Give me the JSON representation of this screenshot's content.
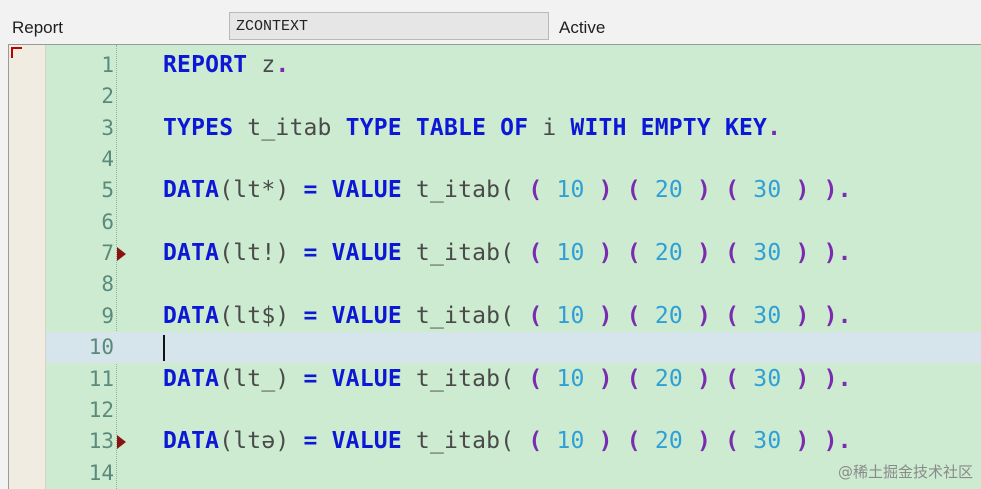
{
  "header": {
    "type_label": "Report",
    "program_name": "ZCONTEXT",
    "status": "Active"
  },
  "editor": {
    "lines": [
      {
        "num": "1",
        "breakpoint": false,
        "current": false,
        "tokens": [
          [
            "kw",
            "REPORT"
          ],
          [
            "id",
            " z"
          ],
          [
            "pn",
            "."
          ]
        ]
      },
      {
        "num": "2",
        "breakpoint": false,
        "current": false,
        "tokens": []
      },
      {
        "num": "3",
        "breakpoint": false,
        "current": false,
        "tokens": [
          [
            "kw",
            "TYPES"
          ],
          [
            "id",
            " t_itab "
          ],
          [
            "kw",
            "TYPE TABLE OF"
          ],
          [
            "id",
            " i "
          ],
          [
            "kw",
            "WITH EMPTY KEY"
          ],
          [
            "pn",
            "."
          ]
        ]
      },
      {
        "num": "4",
        "breakpoint": false,
        "current": false,
        "tokens": []
      },
      {
        "num": "5",
        "breakpoint": false,
        "current": false,
        "tokens": [
          [
            "kw",
            "DATA"
          ],
          [
            "id",
            "(lt*) "
          ],
          [
            "kw",
            "="
          ],
          [
            "id",
            " "
          ],
          [
            "kw",
            "VALUE"
          ],
          [
            "id",
            " t_itab( "
          ],
          [
            "pn",
            "("
          ],
          [
            "id",
            " "
          ],
          [
            "num",
            "10"
          ],
          [
            "id",
            " "
          ],
          [
            "pn",
            ")"
          ],
          [
            "id",
            " "
          ],
          [
            "pn",
            "("
          ],
          [
            "id",
            " "
          ],
          [
            "num",
            "20"
          ],
          [
            "id",
            " "
          ],
          [
            "pn",
            ")"
          ],
          [
            "id",
            " "
          ],
          [
            "pn",
            "("
          ],
          [
            "id",
            " "
          ],
          [
            "num",
            "30"
          ],
          [
            "id",
            " "
          ],
          [
            "pn",
            ")"
          ],
          [
            "id",
            " "
          ],
          [
            "pn",
            ")."
          ]
        ]
      },
      {
        "num": "6",
        "breakpoint": false,
        "current": false,
        "tokens": []
      },
      {
        "num": "7",
        "breakpoint": true,
        "current": false,
        "tokens": [
          [
            "kw",
            "DATA"
          ],
          [
            "id",
            "(lt!) "
          ],
          [
            "kw",
            "="
          ],
          [
            "id",
            " "
          ],
          [
            "kw",
            "VALUE"
          ],
          [
            "id",
            " t_itab( "
          ],
          [
            "pn",
            "("
          ],
          [
            "id",
            " "
          ],
          [
            "num",
            "10"
          ],
          [
            "id",
            " "
          ],
          [
            "pn",
            ")"
          ],
          [
            "id",
            " "
          ],
          [
            "pn",
            "("
          ],
          [
            "id",
            " "
          ],
          [
            "num",
            "20"
          ],
          [
            "id",
            " "
          ],
          [
            "pn",
            ")"
          ],
          [
            "id",
            " "
          ],
          [
            "pn",
            "("
          ],
          [
            "id",
            " "
          ],
          [
            "num",
            "30"
          ],
          [
            "id",
            " "
          ],
          [
            "pn",
            ")"
          ],
          [
            "id",
            " "
          ],
          [
            "pn",
            ")."
          ]
        ]
      },
      {
        "num": "8",
        "breakpoint": false,
        "current": false,
        "tokens": []
      },
      {
        "num": "9",
        "breakpoint": false,
        "current": false,
        "tokens": [
          [
            "kw",
            "DATA"
          ],
          [
            "id",
            "(lt$) "
          ],
          [
            "kw",
            "="
          ],
          [
            "id",
            " "
          ],
          [
            "kw",
            "VALUE"
          ],
          [
            "id",
            " t_itab( "
          ],
          [
            "pn",
            "("
          ],
          [
            "id",
            " "
          ],
          [
            "num",
            "10"
          ],
          [
            "id",
            " "
          ],
          [
            "pn",
            ")"
          ],
          [
            "id",
            " "
          ],
          [
            "pn",
            "("
          ],
          [
            "id",
            " "
          ],
          [
            "num",
            "20"
          ],
          [
            "id",
            " "
          ],
          [
            "pn",
            ")"
          ],
          [
            "id",
            " "
          ],
          [
            "pn",
            "("
          ],
          [
            "id",
            " "
          ],
          [
            "num",
            "30"
          ],
          [
            "id",
            " "
          ],
          [
            "pn",
            ")"
          ],
          [
            "id",
            " "
          ],
          [
            "pn",
            ")."
          ]
        ]
      },
      {
        "num": "10",
        "breakpoint": false,
        "current": true,
        "tokens": []
      },
      {
        "num": "11",
        "breakpoint": false,
        "current": false,
        "tokens": [
          [
            "kw",
            "DATA"
          ],
          [
            "id",
            "(lt_) "
          ],
          [
            "kw",
            "="
          ],
          [
            "id",
            " "
          ],
          [
            "kw",
            "VALUE"
          ],
          [
            "id",
            " t_itab( "
          ],
          [
            "pn",
            "("
          ],
          [
            "id",
            " "
          ],
          [
            "num",
            "10"
          ],
          [
            "id",
            " "
          ],
          [
            "pn",
            ")"
          ],
          [
            "id",
            " "
          ],
          [
            "pn",
            "("
          ],
          [
            "id",
            " "
          ],
          [
            "num",
            "20"
          ],
          [
            "id",
            " "
          ],
          [
            "pn",
            ")"
          ],
          [
            "id",
            " "
          ],
          [
            "pn",
            "("
          ],
          [
            "id",
            " "
          ],
          [
            "num",
            "30"
          ],
          [
            "id",
            " "
          ],
          [
            "pn",
            ")"
          ],
          [
            "id",
            " "
          ],
          [
            "pn",
            ")."
          ]
        ]
      },
      {
        "num": "12",
        "breakpoint": false,
        "current": false,
        "tokens": []
      },
      {
        "num": "13",
        "breakpoint": true,
        "current": false,
        "tokens": [
          [
            "kw",
            "DATA"
          ],
          [
            "id",
            "(ltə) "
          ],
          [
            "kw",
            "="
          ],
          [
            "id",
            " "
          ],
          [
            "kw",
            "VALUE"
          ],
          [
            "id",
            " t_itab( "
          ],
          [
            "pn",
            "("
          ],
          [
            "id",
            " "
          ],
          [
            "num",
            "10"
          ],
          [
            "id",
            " "
          ],
          [
            "pn",
            ")"
          ],
          [
            "id",
            " "
          ],
          [
            "pn",
            "("
          ],
          [
            "id",
            " "
          ],
          [
            "num",
            "20"
          ],
          [
            "id",
            " "
          ],
          [
            "pn",
            ")"
          ],
          [
            "id",
            " "
          ],
          [
            "pn",
            "("
          ],
          [
            "id",
            " "
          ],
          [
            "num",
            "30"
          ],
          [
            "id",
            " "
          ],
          [
            "pn",
            ")"
          ],
          [
            "id",
            " "
          ],
          [
            "pn",
            ")."
          ]
        ]
      },
      {
        "num": "14",
        "breakpoint": false,
        "current": false,
        "tokens": []
      }
    ]
  },
  "watermark": "@稀土掘金技术社区",
  "colors": {
    "editor_bg": "#cdebd0",
    "keyword": "#0d17d6",
    "number": "#2f9fd6",
    "current_line": "#d6e4ec",
    "breakpoint": "#8b1212"
  }
}
